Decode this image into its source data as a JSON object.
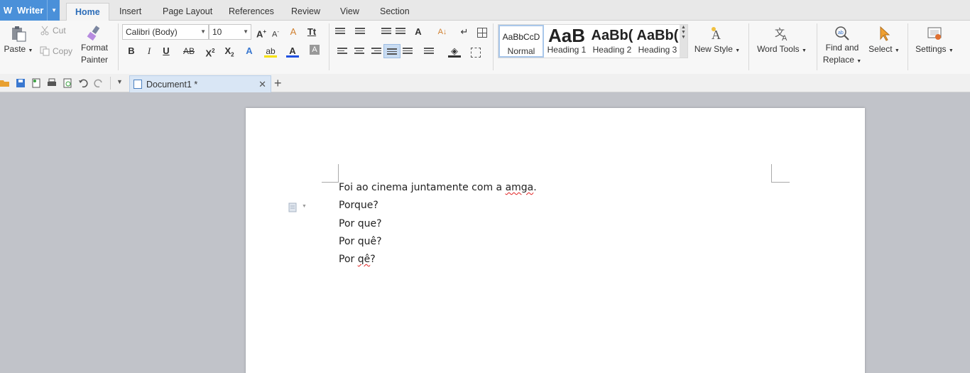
{
  "app": {
    "name": "Writer"
  },
  "menu_tabs": [
    "Home",
    "Insert",
    "Page Layout",
    "References",
    "Review",
    "View",
    "Section"
  ],
  "ribbon": {
    "paste": "Paste",
    "cut": "Cut",
    "copy": "Copy",
    "format_painter_line1": "Format",
    "format_painter_line2": "Painter",
    "font_name": "Calibri (Body)",
    "font_size": "10",
    "styles": [
      {
        "sample": "AaBbCcD",
        "name": "Normal"
      },
      {
        "sample": "AaB",
        "name": "Heading 1"
      },
      {
        "sample": "AaBb(",
        "name": "Heading 2"
      },
      {
        "sample": "AaBb(",
        "name": "Heading 3"
      }
    ],
    "new_style": "New Style",
    "word_tools": "Word Tools",
    "find_replace_line1": "Find and",
    "find_replace_line2": "Replace",
    "select": "Select",
    "settings": "Settings"
  },
  "tabs": {
    "document_title": "Document1 *"
  },
  "document": {
    "lines": [
      {
        "before": "Foi ao cinema juntamente com a ",
        "flagged": "amga",
        "after": "."
      },
      {
        "before": "Porque?",
        "flagged": "",
        "after": ""
      },
      {
        "before": "Por que?",
        "flagged": "",
        "after": ""
      },
      {
        "before": "Por quê?",
        "flagged": "",
        "after": ""
      },
      {
        "before": "Por ",
        "flagged": "qê",
        "after": "?"
      }
    ]
  },
  "colors": {
    "accent": "#4a90d9",
    "active_tab_text": "#2b6cb8",
    "spell_error": "#e02020",
    "workspace": "#c1c3c9"
  }
}
